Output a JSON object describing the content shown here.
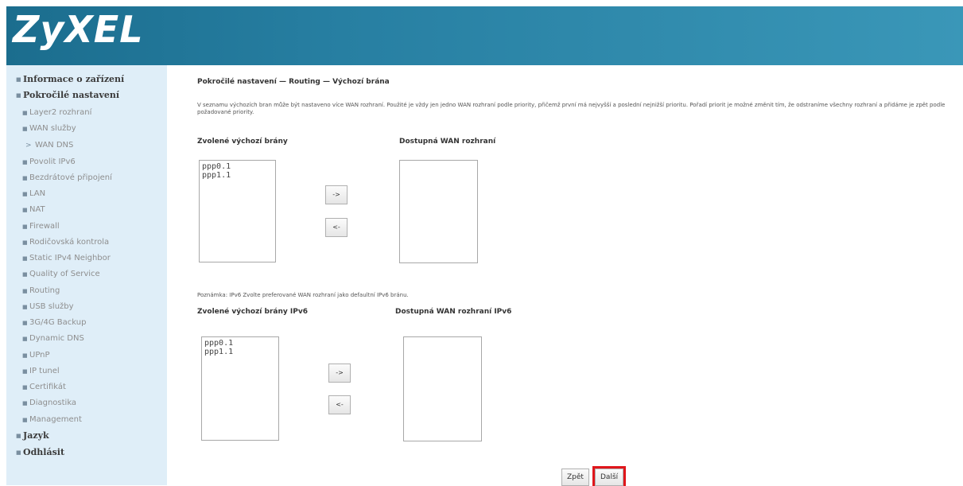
{
  "header": {
    "logo_text": "ZyXEL",
    "bg_color": "#277fa2"
  },
  "sidebar": {
    "bg_color": "#dfeef8",
    "items": [
      {
        "label": "Informace o zařízení"
      },
      {
        "label": "Pokročilé nastavení"
      },
      {
        "label": "Layer2 rozhraní"
      },
      {
        "label": "WAN služby"
      },
      {
        "label": "WAN DNS"
      },
      {
        "label": "Povolit IPv6"
      },
      {
        "label": "Bezdrátové připojení"
      },
      {
        "label": "LAN"
      },
      {
        "label": "NAT"
      },
      {
        "label": "Firewall"
      },
      {
        "label": "Rodičovská kontrola"
      },
      {
        "label": "Static IPv4 Neighbor"
      },
      {
        "label": "Quality of Service"
      },
      {
        "label": "Routing"
      },
      {
        "label": "USB služby"
      },
      {
        "label": "3G/4G Backup"
      },
      {
        "label": "Dynamic DNS"
      },
      {
        "label": "UPnP"
      },
      {
        "label": "IP tunel"
      },
      {
        "label": "Certifikát"
      },
      {
        "label": "Diagnostika"
      },
      {
        "label": "Management"
      },
      {
        "label": "Jazyk"
      },
      {
        "label": "Odhlásit"
      }
    ]
  },
  "main": {
    "breadcrumb": "Pokročilé nastavení — Routing — Výchozí brána",
    "description": "V seznamu výchozích bran může být nastaveno více WAN rozhraní. Použité je vždy jen jedno WAN rozhraní podle priority, přičemž první má nejvyšší a poslední nejnižší prioritu. Pořadí priorit je možné změnit tím, že odstraníme všechny rozhraní a přidáme je zpět podle požadované priority.",
    "ipv4": {
      "selected_label": "Zvolené výchozí brány",
      "available_label": "Dostupná WAN rozhraní",
      "selected_items": [
        "ppp0.1",
        "ppp1.1"
      ],
      "add_button": "->",
      "remove_button": "<-"
    },
    "note": "Poznámka: IPv6 Zvolte preferované WAN rozhraní jako defaultní IPv6 bránu.",
    "ipv6": {
      "selected_label": "Zvolené výchozí brány IPv6",
      "available_label": "Dostupná WAN rozhraní IPv6",
      "selected_items": [
        "ppp0.1",
        "ppp1.1"
      ],
      "add_button": "->",
      "remove_button": "<-"
    },
    "back_button": "Zpět",
    "next_button": "Další",
    "highlight_color": "#e0161b"
  }
}
